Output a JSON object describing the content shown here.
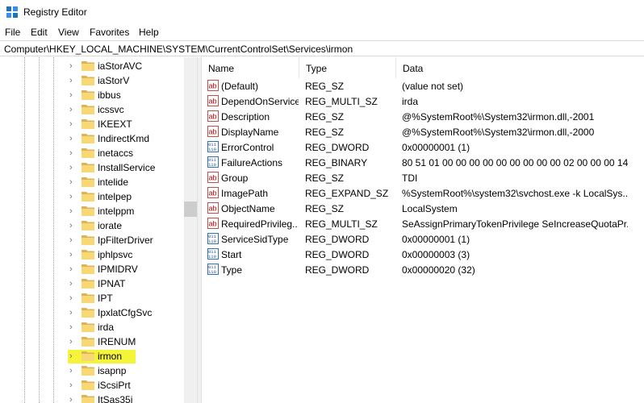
{
  "window": {
    "title": "Registry Editor"
  },
  "menu": [
    "File",
    "Edit",
    "View",
    "Favorites",
    "Help"
  ],
  "address": "Computer\\HKEY_LOCAL_MACHINE\\SYSTEM\\CurrentControlSet\\Services\\irmon",
  "tree": {
    "items": [
      {
        "label": "iaStorAVC"
      },
      {
        "label": "iaStorV"
      },
      {
        "label": "ibbus"
      },
      {
        "label": "icssvc"
      },
      {
        "label": "IKEEXT"
      },
      {
        "label": "IndirectKmd"
      },
      {
        "label": "inetaccs"
      },
      {
        "label": "InstallService"
      },
      {
        "label": "intelide"
      },
      {
        "label": "intelpep"
      },
      {
        "label": "intelppm"
      },
      {
        "label": "iorate"
      },
      {
        "label": "IpFilterDriver"
      },
      {
        "label": "iphlpsvc"
      },
      {
        "label": "IPMIDRV"
      },
      {
        "label": "IPNAT"
      },
      {
        "label": "IPT"
      },
      {
        "label": "IpxlatCfgSvc"
      },
      {
        "label": "irda"
      },
      {
        "label": "IRENUM"
      },
      {
        "label": "irmon",
        "selected": true,
        "highlight_color": "#f4f43a"
      },
      {
        "label": "isapnp"
      },
      {
        "label": "iScsiPrt"
      },
      {
        "label": "ItSas35i"
      }
    ]
  },
  "values": {
    "columns": {
      "name": "Name",
      "type": "Type",
      "data": "Data"
    },
    "rows": [
      {
        "icon": "string-value-icon",
        "name": "(Default)",
        "type": "REG_SZ",
        "data": "(value not set)"
      },
      {
        "icon": "string-value-icon",
        "name": "DependOnService",
        "type": "REG_MULTI_SZ",
        "data": "irda"
      },
      {
        "icon": "string-value-icon",
        "name": "Description",
        "type": "REG_SZ",
        "data": "@%SystemRoot%\\System32\\irmon.dll,-2001"
      },
      {
        "icon": "string-value-icon",
        "name": "DisplayName",
        "type": "REG_SZ",
        "data": "@%SystemRoot%\\System32\\irmon.dll,-2000"
      },
      {
        "icon": "binary-value-icon",
        "name": "ErrorControl",
        "type": "REG_DWORD",
        "data": "0x00000001 (1)"
      },
      {
        "icon": "binary-value-icon",
        "name": "FailureActions",
        "type": "REG_BINARY",
        "data": "80 51 01 00 00 00 00 00 00 00 00 00 02 00 00 00 14 00..."
      },
      {
        "icon": "string-value-icon",
        "name": "Group",
        "type": "REG_SZ",
        "data": "TDI"
      },
      {
        "icon": "string-value-icon",
        "name": "ImagePath",
        "type": "REG_EXPAND_SZ",
        "data": "%SystemRoot%\\system32\\svchost.exe -k LocalSys..."
      },
      {
        "icon": "string-value-icon",
        "name": "ObjectName",
        "type": "REG_SZ",
        "data": "LocalSystem"
      },
      {
        "icon": "string-value-icon",
        "name": "RequiredPrivileg...",
        "type": "REG_MULTI_SZ",
        "data": "SeAssignPrimaryTokenPrivilege SeIncreaseQuotaPr..."
      },
      {
        "icon": "binary-value-icon",
        "name": "ServiceSidType",
        "type": "REG_DWORD",
        "data": "0x00000001 (1)"
      },
      {
        "icon": "binary-value-icon",
        "name": "Start",
        "type": "REG_DWORD",
        "data": "0x00000003 (3)"
      },
      {
        "icon": "binary-value-icon",
        "name": "Type",
        "type": "REG_DWORD",
        "data": "0x00000020 (32)"
      }
    ]
  }
}
